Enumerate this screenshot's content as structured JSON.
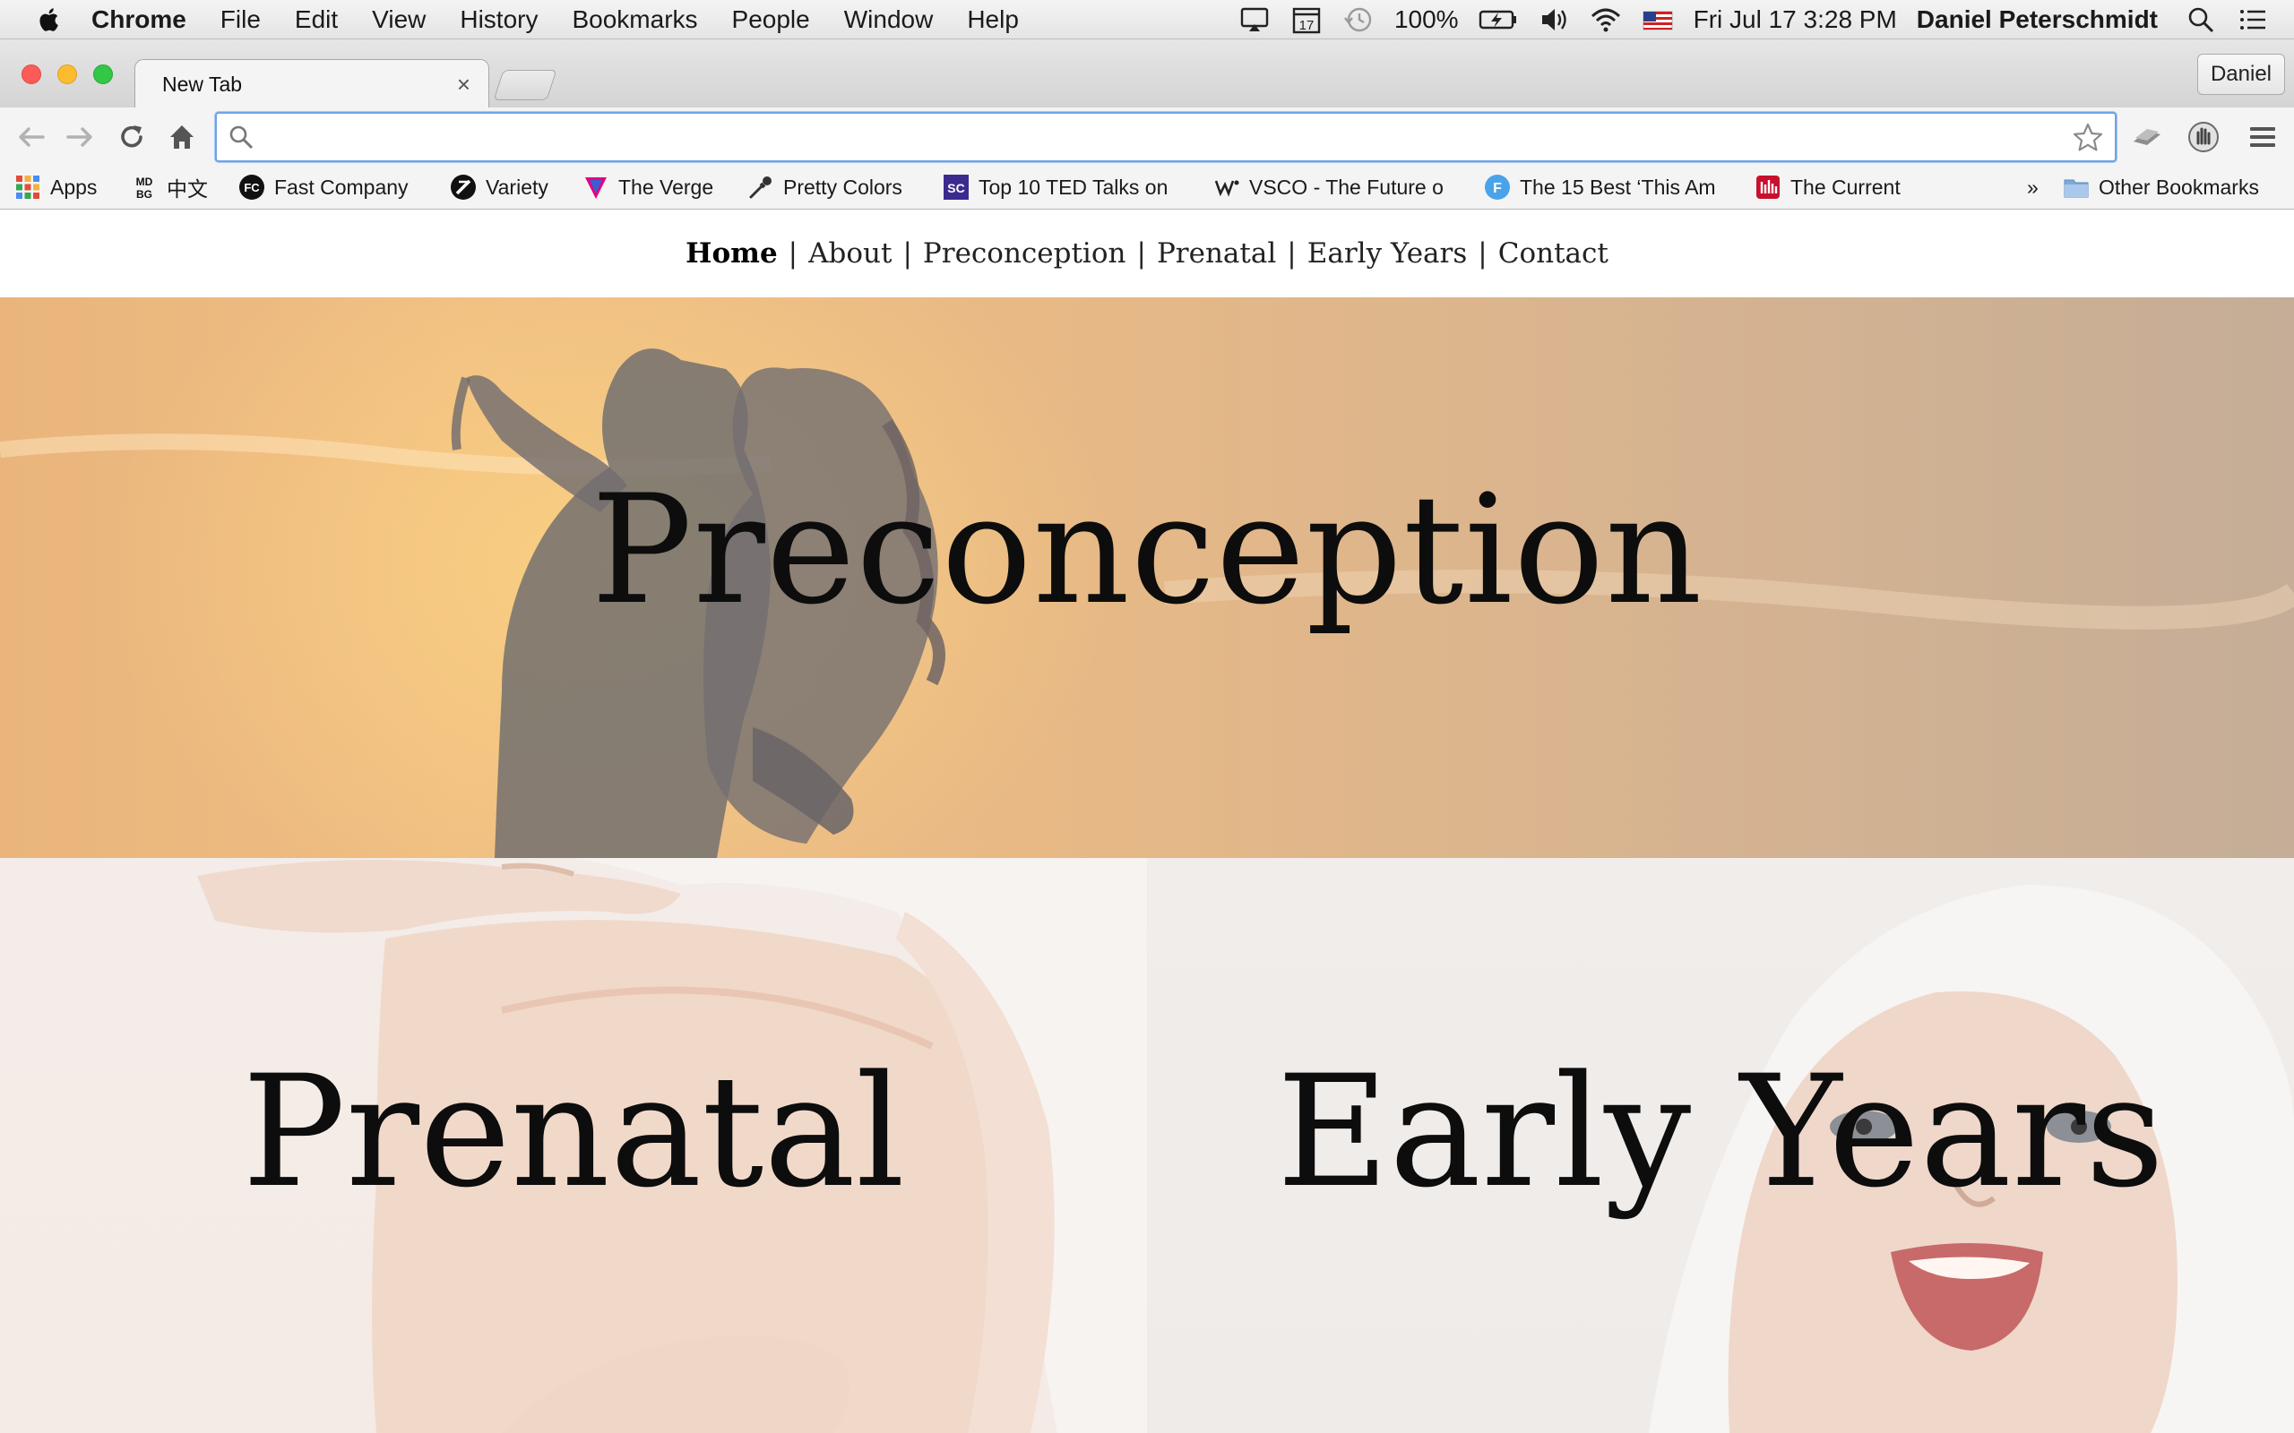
{
  "os_menubar": {
    "app_name": "Chrome",
    "menus": [
      "File",
      "Edit",
      "View",
      "History",
      "Bookmarks",
      "People",
      "Window",
      "Help"
    ],
    "status": {
      "calendar_day": "17",
      "battery": "100%",
      "datetime": "Fri Jul 17  3:28 PM",
      "user": "Daniel Peterschmidt"
    }
  },
  "browser": {
    "tab_title": "New Tab",
    "tab_close": "×",
    "profile_button": "Daniel",
    "omnibox": {
      "value": "",
      "placeholder": ""
    },
    "bookmarks": [
      {
        "label": "Apps",
        "icon": "apps-grid-icon"
      },
      {
        "label": "中文",
        "icon": "mdbg-icon",
        "icon_text": "MD BG"
      },
      {
        "label": "Fast Company",
        "icon": "fast-company-icon",
        "icon_text": "FC"
      },
      {
        "label": "Variety",
        "icon": "variety-icon"
      },
      {
        "label": "The Verge",
        "icon": "verge-icon"
      },
      {
        "label": "Pretty Colors",
        "icon": "eyedropper-icon"
      },
      {
        "label": "Top 10 TED Talks on",
        "icon": "soundcloud-icon",
        "icon_text": "SC"
      },
      {
        "label": "VSCO - The Future o",
        "icon": "vsco-icon"
      },
      {
        "label": "The 15 Best ‘This Am",
        "icon": "f-circle-icon",
        "icon_text": "F"
      },
      {
        "label": "The Current",
        "icon": "the-current-icon"
      }
    ],
    "overflow_chevron": "»",
    "other_bookmarks": "Other Bookmarks"
  },
  "site": {
    "nav": [
      {
        "label": "Home",
        "active": true
      },
      {
        "label": "About",
        "active": false
      },
      {
        "label": "Preconception",
        "active": false
      },
      {
        "label": "Prenatal",
        "active": false
      },
      {
        "label": "Early Years",
        "active": false
      },
      {
        "label": "Contact",
        "active": false
      }
    ],
    "nav_separator": "|",
    "hero": {
      "title": "Preconception"
    },
    "panels": [
      {
        "title": "Prenatal"
      },
      {
        "title": "Early Years"
      }
    ]
  },
  "colors": {
    "menubar_bg": "#ececec",
    "omnibox_focus": "#6fa3e6",
    "hero_warm": "#efbd83",
    "heading_text": "#0d0d0d",
    "close_button": "#fc5b57",
    "minimize_button": "#fdbc2f",
    "zoom_button": "#33c748"
  }
}
